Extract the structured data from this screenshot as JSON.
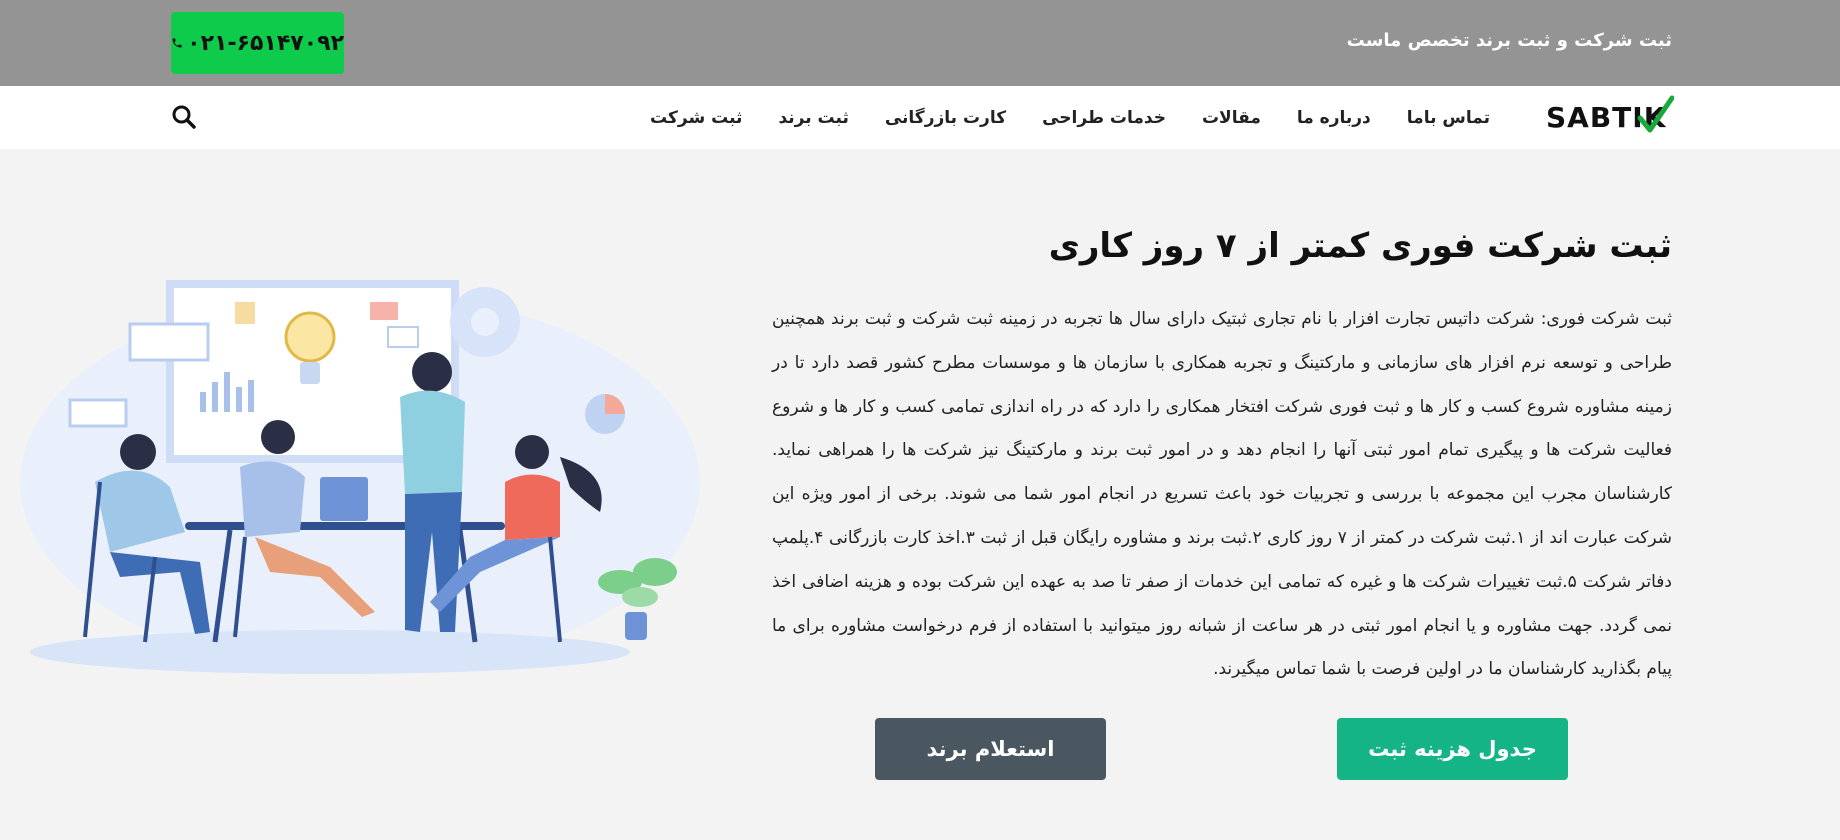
{
  "topbar": {
    "phone": "۰۲۱-۶۵۱۴۷۰۹۲",
    "tagline": "ثبت شرکت و ثبت برند تخصص ماست"
  },
  "navbar": {
    "logo": "SABTIK",
    "items": [
      {
        "label": "ثبت شرکت"
      },
      {
        "label": "ثبت برند"
      },
      {
        "label": "کارت بازرگانی"
      },
      {
        "label": "خدمات طراحی"
      },
      {
        "label": "مقالات"
      },
      {
        "label": "درباره ما"
      },
      {
        "label": "تماس باما"
      }
    ],
    "search_icon": "search-icon"
  },
  "hero": {
    "title": "ثبت شرکت فوری کمتر از ۷ روز کاری",
    "text": "ثبت شرکت فوری: شرکت داتیس تجارت افزار با نام تجاری ثبتیک دارای سال ها تجربه در زمینه ثبت شرکت و ثبت برند همچنین طراحی و توسعه نرم افزار های سازمانی و مارکتینگ و تجربه همکاری با سازمان ها و موسسات مطرح کشور قصد دارد تا در زمینه مشاوره شروع کسب و کار ها و ثبت فوری شرکت افتخار همکاری را دارد که در راه اندازی تمامی کسب و کار ها و شروع فعالیت شرکت ها و پیگیری تمام امور ثبتی آنها را انجام دهد و در امور ثبت برند و مارکتینگ نیز شرکت ها را همراهی نماید. کارشناسان مجرب این مجموعه با بررسی و تجربیات خود باعث تسریع در انجام امور شما می شوند. برخی از امور ویژه این شرکت عبارت اند از ۱.ثبت شرکت در کمتر از ۷ روز کاری ۲.ثبت برند و مشاوره رایگان قبل از ثبت ۳.اخذ کارت بازرگانی ۴.پلمپ دفاتر شرکت ۵.ثبت تغییرات شرکت ها و غیره که تمامی این خدمات از صفر تا صد به عهده این شرکت بوده و هزینه اضافی اخذ نمی گردد. جهت مشاوره و یا انجام امور ثبتی در هر ساعت از شبانه روز میتوانید با استفاده از فرم درخواست مشاوره برای ما پیام بگذارید کارشناسان ما در اولین فرصت با شما تماس میگیرند.",
    "btn_price": "جدول هزینه ثبت",
    "btn_brand": "استعلام برند"
  },
  "colors": {
    "topbar": "#949494",
    "phone_btn": "#0fcb4b",
    "btn_price": "#14b487",
    "btn_brand": "#4a5761",
    "logo_check": "#19a83a"
  }
}
